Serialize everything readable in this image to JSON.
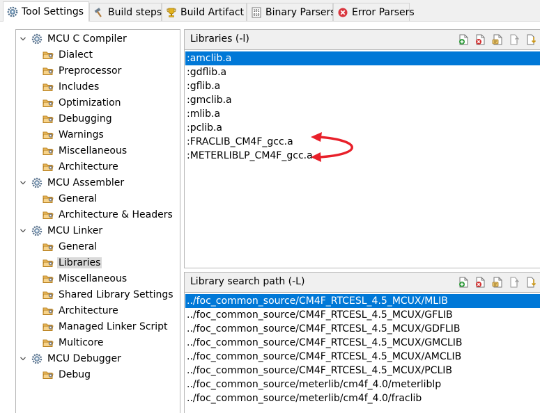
{
  "tabs": [
    {
      "label": "Tool Settings",
      "icon": "gear-icon",
      "active": true
    },
    {
      "label": "Build steps",
      "icon": "hammer-icon",
      "active": false
    },
    {
      "label": "Build Artifact",
      "icon": "trophy-icon",
      "active": false
    },
    {
      "label": "Binary Parsers",
      "icon": "binary-icon",
      "active": false
    },
    {
      "label": "Error Parsers",
      "icon": "error-icon",
      "active": false
    }
  ],
  "tree": {
    "groups": [
      {
        "label": "MCU C Compiler",
        "items": [
          "Dialect",
          "Preprocessor",
          "Includes",
          "Optimization",
          "Debugging",
          "Warnings",
          "Miscellaneous",
          "Architecture"
        ]
      },
      {
        "label": "MCU Assembler",
        "items": [
          "General",
          "Architecture & Headers"
        ]
      },
      {
        "label": "MCU Linker",
        "items": [
          "General",
          "Libraries",
          "Miscellaneous",
          "Shared Library Settings",
          "Architecture",
          "Managed Linker Script",
          "Multicore"
        ]
      },
      {
        "label": "MCU Debugger",
        "items": [
          "Debug"
        ]
      }
    ],
    "selected": "Libraries"
  },
  "libraries": {
    "title": "Libraries (-l)",
    "items": [
      ":amclib.a",
      ":gdflib.a",
      ":gflib.a",
      ":gmclib.a",
      ":mlib.a",
      ":pclib.a",
      ":FRACLIB_CM4F_gcc.a",
      ":METERLIBLP_CM4F_gcc.a"
    ],
    "selected_index": 0
  },
  "search_paths": {
    "title": "Library search path (-L)",
    "items": [
      "../foc_common_source/CM4F_RTCESL_4.5_MCUX/MLIB",
      "../foc_common_source/CM4F_RTCESL_4.5_MCUX/GFLIB",
      "../foc_common_source/CM4F_RTCESL_4.5_MCUX/GDFLIB",
      "../foc_common_source/CM4F_RTCESL_4.5_MCUX/GMCLIB",
      "../foc_common_source/CM4F_RTCESL_4.5_MCUX/AMCLIB",
      "../foc_common_source/CM4F_RTCESL_4.5_MCUX/PCLIB",
      "../foc_common_source/meterlib/cm4f_4.0/meterliblp",
      "../foc_common_source/meterlib/cm4f_4.0/fraclib"
    ],
    "selected_index": 0
  },
  "toolbar_icons": [
    "add-icon",
    "delete-icon",
    "edit-icon",
    "move-up-icon",
    "move-down-icon"
  ],
  "colors": {
    "selection": "#0078d7",
    "tree_selection": "#dadada",
    "annotation": "#e8202a",
    "folder": "#e8a33a"
  }
}
